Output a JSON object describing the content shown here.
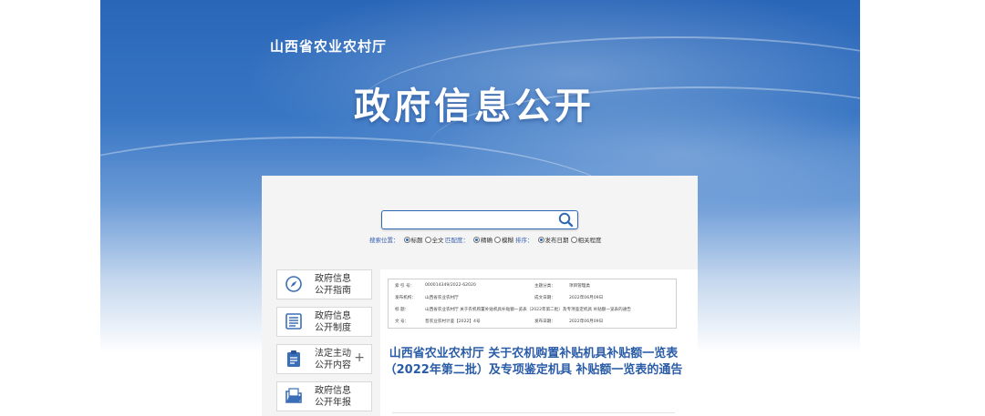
{
  "header": {
    "site_name": "山西省农业农村厅",
    "hero_title": "政府信息公开"
  },
  "search": {
    "value": "",
    "placeholder": "",
    "scope_label": "搜索位置：",
    "scope_options": [
      "标题",
      "全文"
    ],
    "match_label": "匹配度：",
    "match_options": [
      "精确",
      "模糊"
    ],
    "sort_label": "排序：",
    "sort_options": [
      "发布日期",
      "相关程度"
    ]
  },
  "sidebar": {
    "items": [
      {
        "label_line1": "政府信息",
        "label_line2": "公开指南",
        "icon": "compass-icon"
      },
      {
        "label_line1": "政府信息",
        "label_line2": "公开制度",
        "icon": "document-list-icon"
      },
      {
        "label_line1": "法定主动",
        "label_line2": "公开内容",
        "icon": "clipboard-icon",
        "expand": "+"
      },
      {
        "label_line1": "政府信息",
        "label_line2": "公开年报",
        "icon": "folder-icon"
      }
    ]
  },
  "info_table": {
    "index_label": "索 引 号：",
    "index_value": "000014349/2022-62020",
    "category_label": "主题分类：",
    "category_value": "项目管理类",
    "publisher_label": "发布机构：",
    "publisher_value": "山西省农业农村厅",
    "created_label": "成文日期：",
    "created_value": "2022年06月09日",
    "title_label": "标    题：",
    "title_value": "山西省农业农村厅 关于农机购置补贴机具补贴额一览表（2022年第二批）及专项鉴定机具 补贴额一览表的通告",
    "docno_label": "文    号：",
    "docno_value": "晋农业农村计鉴【2022】4号",
    "published_label": "发布日期：",
    "published_value": "2022年06月09日"
  },
  "article": {
    "title": "山西省农业农村厅 关于农机购置补贴机具补贴额一览表（2022年第二批）及专项鉴定机具 补贴额一览表的通告"
  },
  "colors": {
    "banner_blue": "#2a66b8",
    "title_blue": "#2a5ca8",
    "card_bg": "#f4f4f4"
  }
}
